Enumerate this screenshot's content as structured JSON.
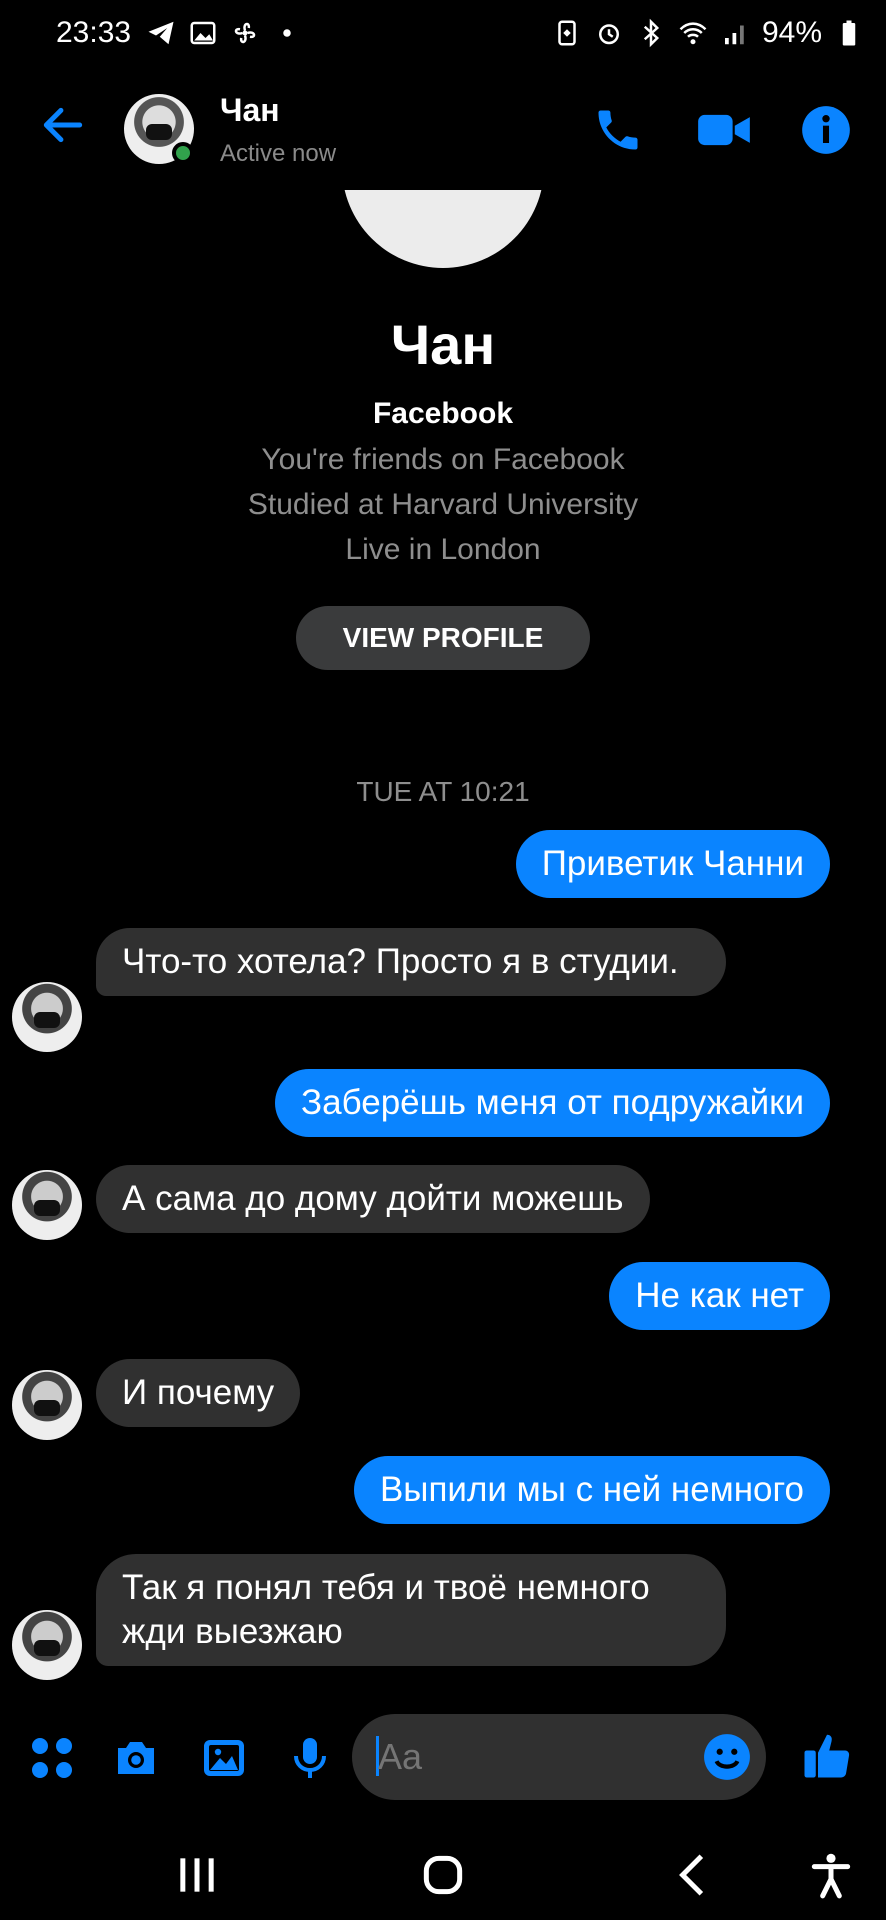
{
  "status_bar": {
    "time": "23:33",
    "battery": "94%"
  },
  "header": {
    "name": "Чан",
    "status": "Active now"
  },
  "profile": {
    "name": "Чан",
    "source": "Facebook",
    "friends": "You're friends on Facebook",
    "education": "Studied at Harvard University",
    "location": "Live in London",
    "view_profile_label": "VIEW PROFILE"
  },
  "conversation": {
    "timestamp": "TUE AT 10:21",
    "messages": [
      {
        "from": "me",
        "text": "Приветик Чанни"
      },
      {
        "from": "them",
        "text": "Что-то хотела? Просто я в студии."
      },
      {
        "from": "me",
        "text": "Заберёшь меня от подружайки"
      },
      {
        "from": "them",
        "text": "А сама до дому дойти можешь"
      },
      {
        "from": "me",
        "text": "Не как нет"
      },
      {
        "from": "them",
        "text": "И почему"
      },
      {
        "from": "me",
        "text": "Выпили мы с ней немного"
      },
      {
        "from": "them",
        "text": "Так я понял тебя и твоё немного жди выезжаю"
      }
    ]
  },
  "composer": {
    "placeholder": "Aa"
  },
  "colors": {
    "accent": "#0a84ff",
    "incoming_bubble": "#303030",
    "background": "#000000",
    "online": "#31a24c"
  },
  "icons": {
    "header": [
      "back-arrow-icon",
      "phone-icon",
      "video-camera-icon",
      "info-icon"
    ],
    "composer": [
      "apps-grid-icon",
      "camera-icon",
      "image-icon",
      "microphone-icon",
      "emoji-icon",
      "thumbs-up-icon"
    ],
    "nav": [
      "recent-apps-icon",
      "home-icon",
      "back-icon",
      "accessibility-icon"
    ]
  }
}
